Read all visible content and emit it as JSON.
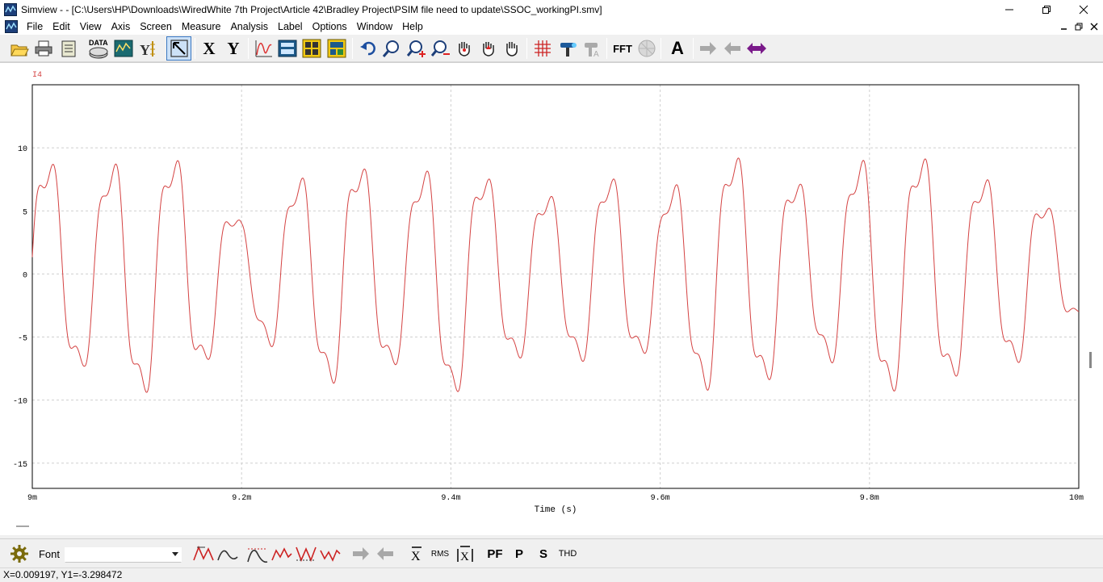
{
  "window": {
    "title": "Simview -  - [C:\\Users\\HP\\Downloads\\WiredWhite 7th Project\\Article 42\\Bradley Project\\PSIM file need to update\\SSOC_workingPI.smv]",
    "controls": [
      "minimize",
      "restore",
      "close"
    ]
  },
  "menu": {
    "items": [
      "File",
      "Edit",
      "View",
      "Axis",
      "Screen",
      "Measure",
      "Analysis",
      "Label",
      "Options",
      "Window",
      "Help"
    ]
  },
  "toolbar": {
    "data_label": "DATA",
    "x_label": "X",
    "y_label": "Y",
    "fft_label": "FFT",
    "text_label": "A",
    "icons": [
      "open-icon",
      "print-icon",
      "clipboard-icon",
      "data-icon",
      "chart-icon",
      "y-axis-icon",
      "select-pointer-icon",
      "x-axis-button",
      "y-axis-button",
      "waveform-icon",
      "measure-table-icon",
      "grid-display-icon",
      "panel-icon",
      "undo-icon",
      "zoom-icon",
      "zoom-in-icon",
      "zoom-out-icon",
      "pan-grab-icon",
      "pan-up-icon",
      "hand-icon",
      "grid-toggle-icon",
      "marker-icon",
      "marker-disabled-icon",
      "fft-button",
      "fft-disabled-icon",
      "text-icon",
      "arrow-right-icon",
      "arrow-left-icon",
      "arrow-both-icon"
    ]
  },
  "plot": {
    "signal_label": "I4",
    "x_axis_label": "Time (s)",
    "x_ticks": [
      "9m",
      "9.2m",
      "9.4m",
      "9.6m",
      "9.8m",
      "10m"
    ],
    "y_ticks": [
      "10",
      "5",
      "0",
      "-5",
      "-10",
      "-15"
    ],
    "trace_color": "#d44242",
    "axis_label_color": "#000000",
    "grid_color": "#cfcfcf"
  },
  "chart_data": {
    "type": "line",
    "title": "",
    "xlabel": "Time (s)",
    "ylabel": "",
    "xlim": [
      0.009,
      0.01
    ],
    "ylim": [
      -17,
      15
    ],
    "grid": true,
    "series": [
      {
        "name": "I4",
        "color": "#d44242",
        "description_values": {
          "x_start": 0.009,
          "x_end": 0.01
        },
        "x": [
          0.009,
          0.00905,
          0.0091,
          0.00915,
          0.0092,
          0.00925,
          0.0093,
          0.00935,
          0.0094,
          0.00945,
          0.0095,
          0.00955,
          0.0096,
          0.00965,
          0.0097,
          0.00975,
          0.0098,
          0.00985,
          0.0099,
          0.00995,
          0.01
        ],
        "envelope_max": [
          11.8,
          9,
          11.9,
          10.8,
          5,
          9,
          11.2,
          8.5,
          11.4,
          8.5,
          7.5,
          9.5,
          7.3,
          11.8,
          10.8,
          7.8,
          11.5,
          11.4,
          9.3,
          8.8,
          3.4
        ],
        "envelope_min": [
          -11.5,
          -9,
          -11.8,
          -10.6,
          -4.6,
          -9,
          -11.2,
          -8.7,
          -11.9,
          -8.5,
          -7.6,
          -9.4,
          -7.1,
          -11.8,
          -10.6,
          -7.7,
          -11.2,
          -11.7,
          -9.1,
          -8.6,
          -3.8
        ]
      }
    ]
  },
  "bottom_toolbar": {
    "font_label": "Font",
    "font_value": "",
    "rms_label": "RMS",
    "pf_label": "PF",
    "p_label": "P",
    "s_label": "S",
    "thd_label": "THD"
  },
  "status": {
    "text": "X=0.009197, Y1=-3.298472"
  }
}
